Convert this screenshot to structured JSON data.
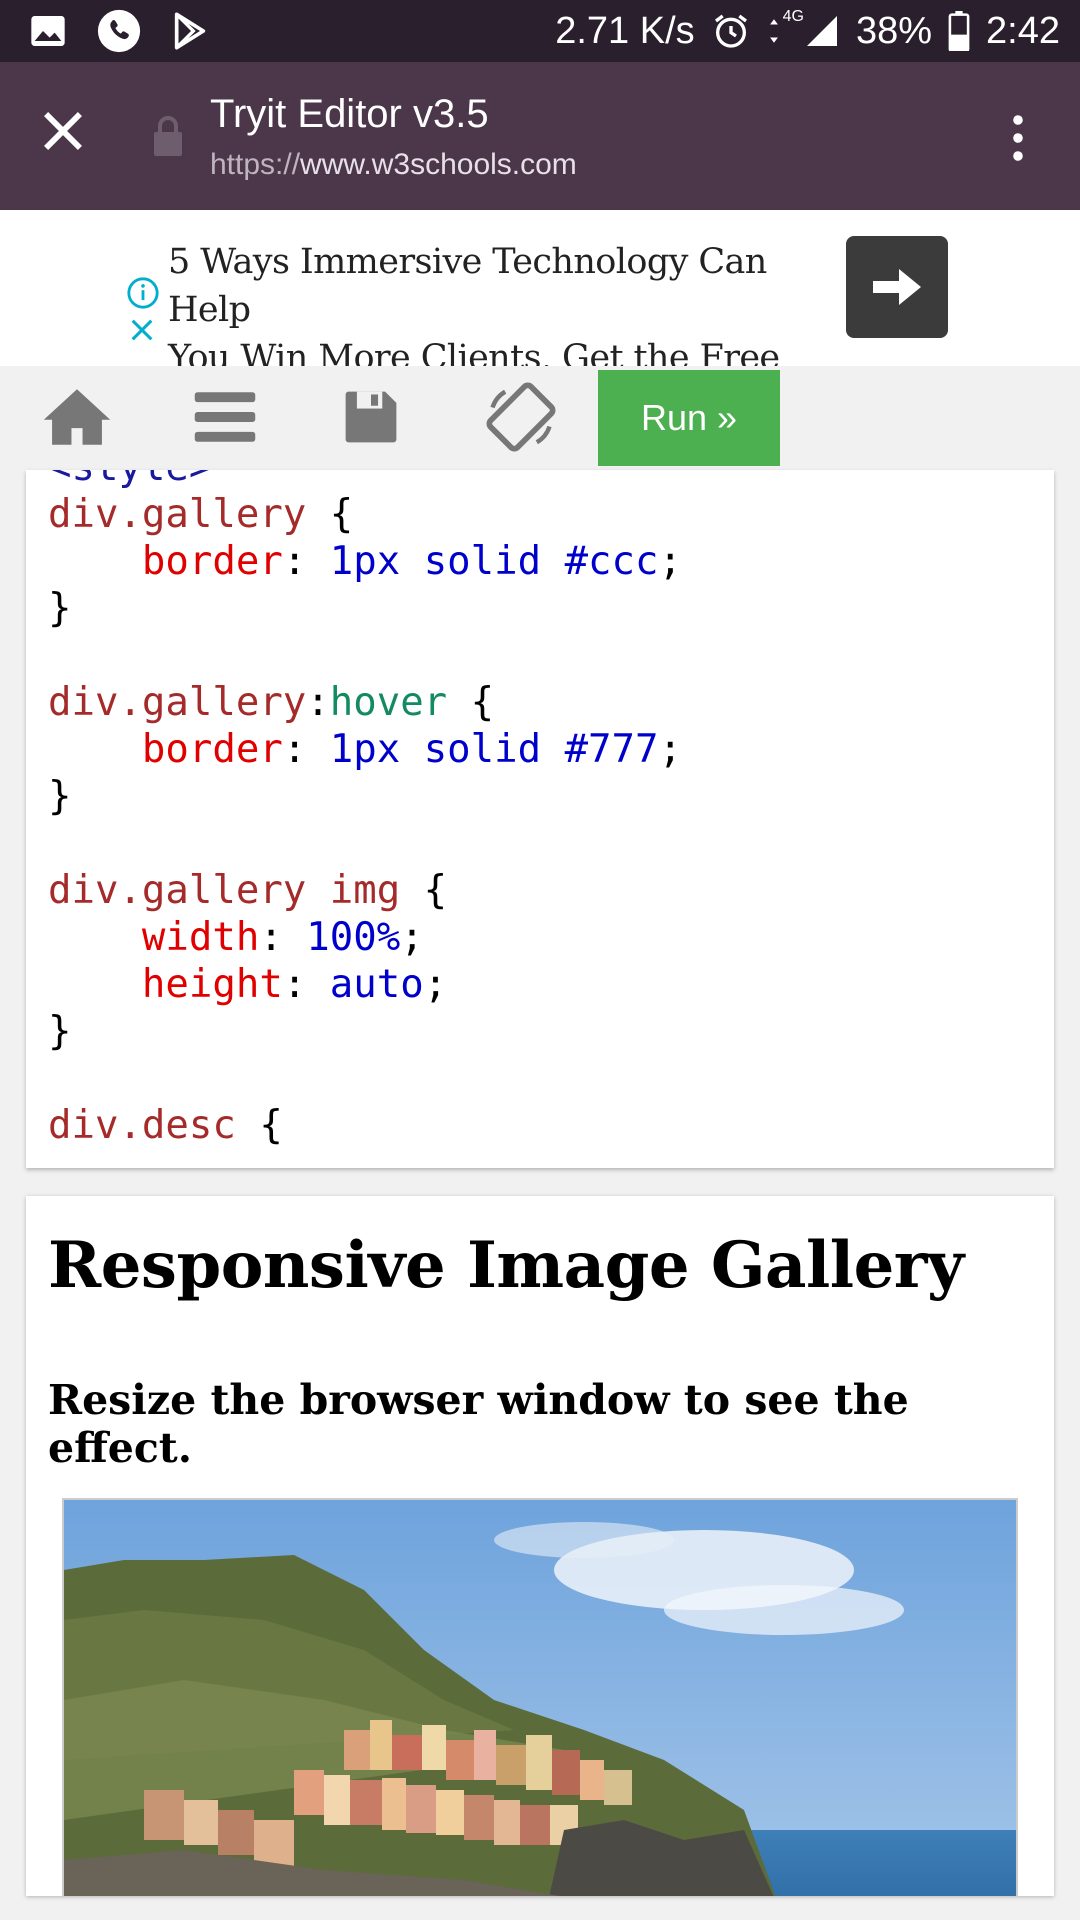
{
  "status_bar": {
    "speed": "2.71 K/s",
    "network": "4G",
    "battery": "38%",
    "time": "2:42",
    "icons": [
      "image-icon",
      "phone-icon",
      "play-store-icon",
      "alarm-icon",
      "data-arrows-icon",
      "signal-icon",
      "battery-icon"
    ]
  },
  "browser": {
    "title": "Tryit Editor v3.5",
    "url_protocol": "https://",
    "url_host": "www.w3schools.com"
  },
  "ad": {
    "line1": "5 Ways Immersive Technology Can Help",
    "line2": "You Win More Clients. Get the Free eBook!"
  },
  "toolbar": {
    "run_label": "Run »"
  },
  "code": {
    "lines": [
      {
        "parts": [
          {
            "c": "tagc",
            "t": "<style>"
          }
        ]
      },
      {
        "parts": [
          {
            "c": "sel",
            "t": "div.gallery"
          },
          {
            "c": "",
            "t": " {"
          }
        ]
      },
      {
        "parts": [
          {
            "c": "",
            "t": "    "
          },
          {
            "c": "prop",
            "t": "border"
          },
          {
            "c": "",
            "t": ": "
          },
          {
            "c": "val",
            "t": "1px solid #ccc"
          },
          {
            "c": "",
            "t": ";"
          }
        ]
      },
      {
        "parts": [
          {
            "c": "",
            "t": "}"
          }
        ]
      },
      {
        "parts": [
          {
            "c": "",
            "t": ""
          }
        ]
      },
      {
        "parts": [
          {
            "c": "sel",
            "t": "div.gallery"
          },
          {
            "c": "",
            "t": ":"
          },
          {
            "c": "pseudo",
            "t": "hover"
          },
          {
            "c": "",
            "t": " {"
          }
        ]
      },
      {
        "parts": [
          {
            "c": "",
            "t": "    "
          },
          {
            "c": "prop",
            "t": "border"
          },
          {
            "c": "",
            "t": ": "
          },
          {
            "c": "val",
            "t": "1px solid #777"
          },
          {
            "c": "",
            "t": ";"
          }
        ]
      },
      {
        "parts": [
          {
            "c": "",
            "t": "}"
          }
        ]
      },
      {
        "parts": [
          {
            "c": "",
            "t": ""
          }
        ]
      },
      {
        "parts": [
          {
            "c": "sel",
            "t": "div.gallery img"
          },
          {
            "c": "",
            "t": " {"
          }
        ]
      },
      {
        "parts": [
          {
            "c": "",
            "t": "    "
          },
          {
            "c": "prop",
            "t": "width"
          },
          {
            "c": "",
            "t": ": "
          },
          {
            "c": "val",
            "t": "100%"
          },
          {
            "c": "",
            "t": ";"
          }
        ]
      },
      {
        "parts": [
          {
            "c": "",
            "t": "    "
          },
          {
            "c": "prop",
            "t": "height"
          },
          {
            "c": "",
            "t": ": "
          },
          {
            "c": "val",
            "t": "auto"
          },
          {
            "c": "",
            "t": ";"
          }
        ]
      },
      {
        "parts": [
          {
            "c": "",
            "t": "}"
          }
        ]
      },
      {
        "parts": [
          {
            "c": "",
            "t": ""
          }
        ]
      },
      {
        "parts": [
          {
            "c": "sel",
            "t": "div.desc"
          },
          {
            "c": "",
            "t": " {"
          }
        ]
      }
    ]
  },
  "result": {
    "heading": "Responsive Image Gallery",
    "subheading": "Resize the browser window to see the effect."
  },
  "colors": {
    "status_bar_bg": "#2a1f2c",
    "browser_bar_bg": "#4b3749",
    "run_button": "#4caf50",
    "ad_arrow_bg": "#3b3b3b"
  }
}
